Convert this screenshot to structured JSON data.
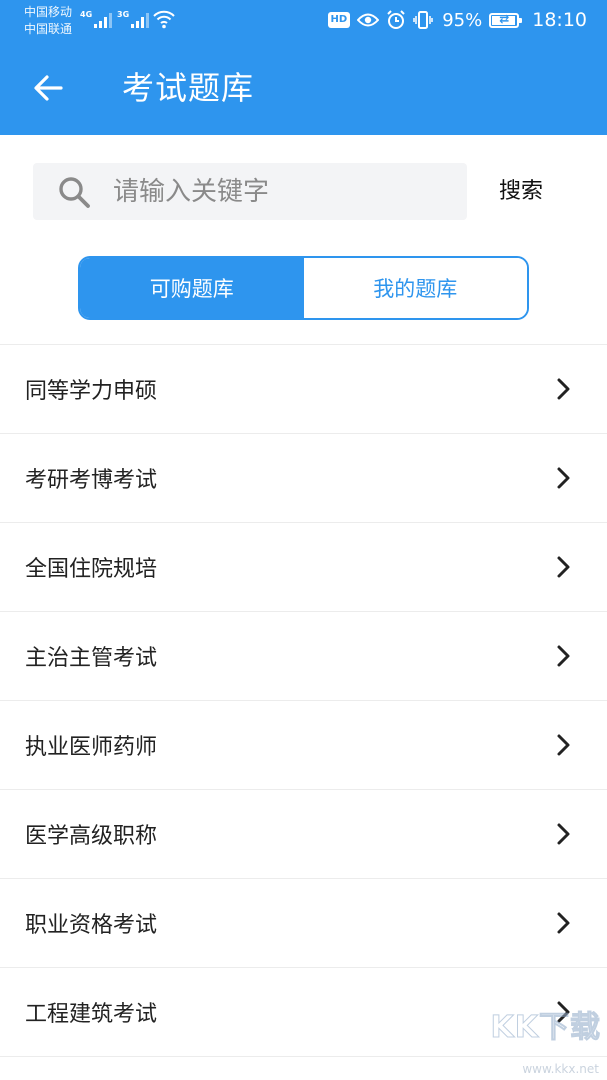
{
  "status_bar": {
    "carrier_1": "中国移动",
    "carrier_2": "中国联通",
    "network_1": "4G",
    "network_2": "3G",
    "hd_badge": "HD",
    "battery_percent": "95%",
    "time": "18:10",
    "icons": [
      "signal-icon",
      "wifi-icon",
      "eye-icon",
      "alarm-icon",
      "vibrate-icon",
      "battery-icon"
    ]
  },
  "app_bar": {
    "title": "考试题库",
    "back_icon": "arrow-left-icon"
  },
  "search": {
    "placeholder": "请输入关键字",
    "value": "",
    "button_label": "搜索",
    "icon": "search-icon"
  },
  "tabs": [
    {
      "label": "可购题库",
      "active": true
    },
    {
      "label": "我的题库",
      "active": false
    }
  ],
  "categories": [
    {
      "label": "同等学力申硕"
    },
    {
      "label": "考研考博考试"
    },
    {
      "label": "全国住院规培"
    },
    {
      "label": "主治主管考试"
    },
    {
      "label": "执业医师药师"
    },
    {
      "label": "医学高级职称"
    },
    {
      "label": "职业资格考试"
    },
    {
      "label": "工程建筑考试"
    }
  ],
  "watermark": {
    "logo": "KK下载",
    "url": "www.kkx.net"
  },
  "colors": {
    "brand": "#2e95ee",
    "search_bg": "#f3f4f6",
    "divider": "#ececec"
  }
}
